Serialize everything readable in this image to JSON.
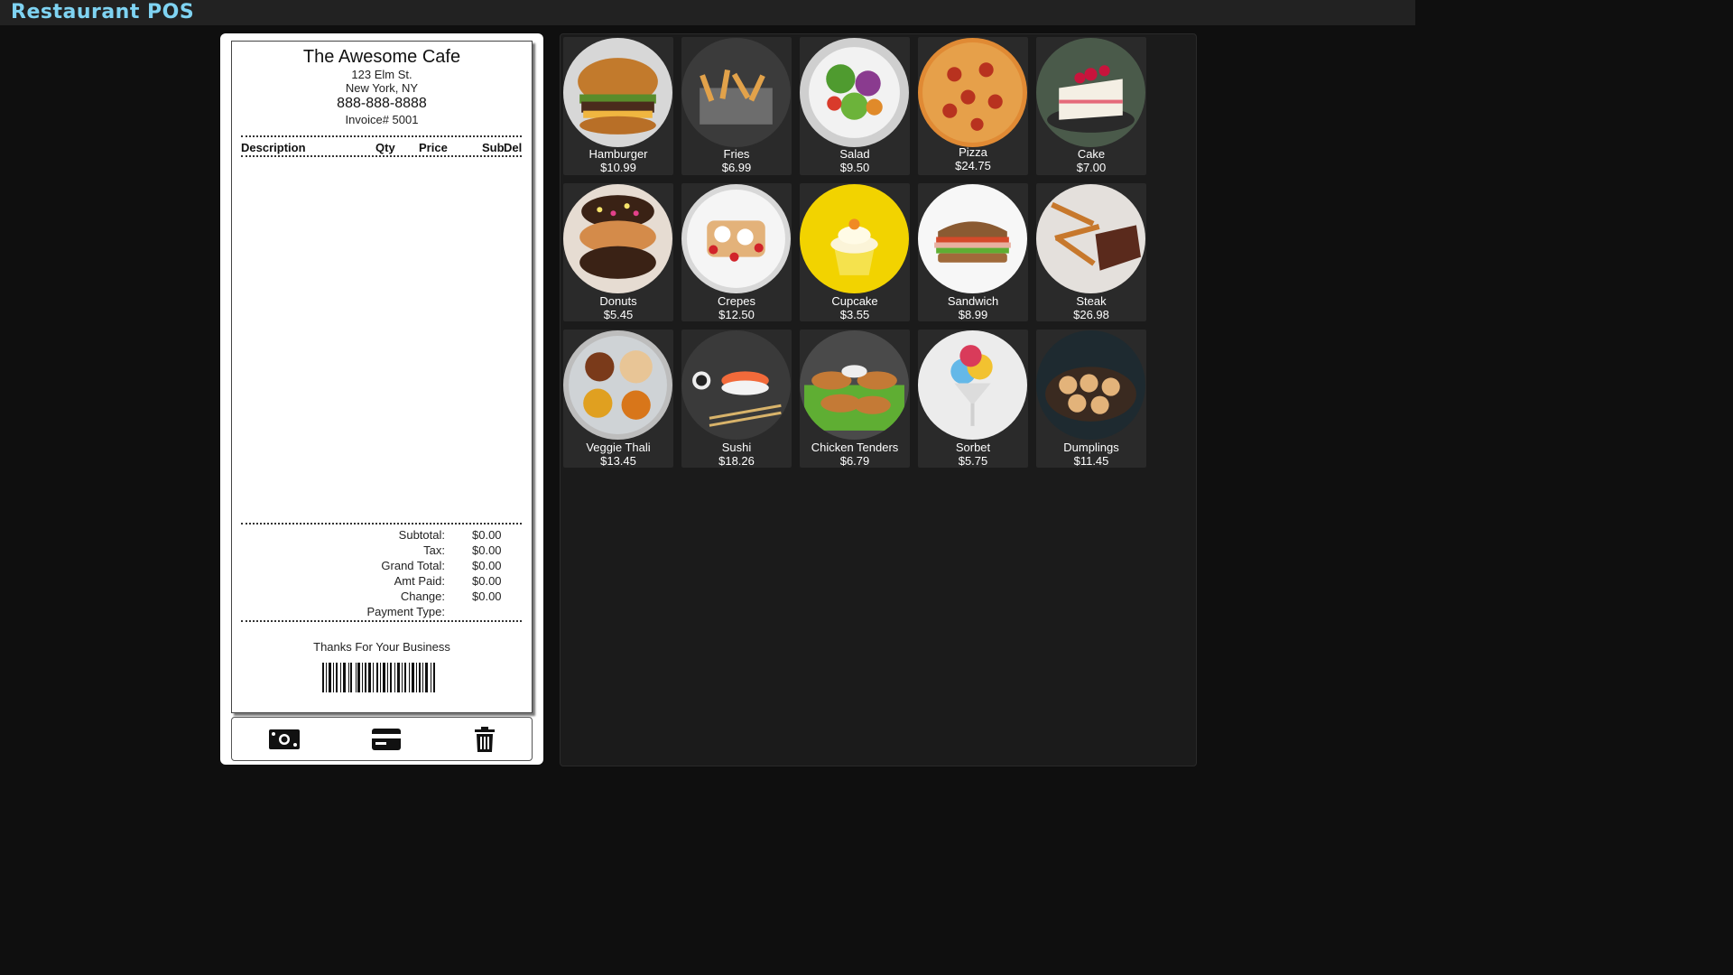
{
  "app": {
    "title": "Restaurant POS"
  },
  "receipt": {
    "shop_name": "The Awesome Cafe",
    "address_line1": "123 Elm St.",
    "address_line2": "New York, NY",
    "phone": "888-888-8888",
    "invoice": "Invoice# 5001",
    "columns": {
      "description": "Description",
      "qty": "Qty",
      "price": "Price",
      "sub": "Sub",
      "del": "Del"
    },
    "items": [],
    "totals": {
      "subtotal_label": "Subtotal:",
      "subtotal": "$0.00",
      "tax_label": "Tax:",
      "tax": "$0.00",
      "grand_label": "Grand Total:",
      "grand": "$0.00",
      "paid_label": "Amt Paid:",
      "paid": "$0.00",
      "change_label": "Change:",
      "change": "$0.00",
      "payment_type_label": "Payment Type:",
      "payment_type": ""
    },
    "footer": "Thanks For Your Business"
  },
  "actions": {
    "cash_icon": "cash-icon",
    "card_icon": "credit-card-icon",
    "clear_icon": "trash-icon"
  },
  "menu": {
    "items": [
      {
        "name": "Hamburger",
        "price": "$10.99"
      },
      {
        "name": "Fries",
        "price": "$6.99"
      },
      {
        "name": "Salad",
        "price": "$9.50"
      },
      {
        "name": "Pizza",
        "price": "$24.75"
      },
      {
        "name": "Cake",
        "price": "$7.00"
      },
      {
        "name": "Donuts",
        "price": "$5.45"
      },
      {
        "name": "Crepes",
        "price": "$12.50"
      },
      {
        "name": "Cupcake",
        "price": "$3.55"
      },
      {
        "name": "Sandwich",
        "price": "$8.99"
      },
      {
        "name": "Steak",
        "price": "$26.98"
      },
      {
        "name": "Veggie Thali",
        "price": "$13.45"
      },
      {
        "name": "Sushi",
        "price": "$18.26"
      },
      {
        "name": "Chicken Tenders",
        "price": "$6.79"
      },
      {
        "name": "Sorbet",
        "price": "$5.75"
      },
      {
        "name": "Dumplings",
        "price": "$11.45"
      }
    ]
  },
  "colors": {
    "title": "#7fd3f2",
    "background": "#0f0f0f",
    "panel": "#1b1b1b",
    "card": "#2a2a2a",
    "cupcake_bg": "#f2d300"
  }
}
